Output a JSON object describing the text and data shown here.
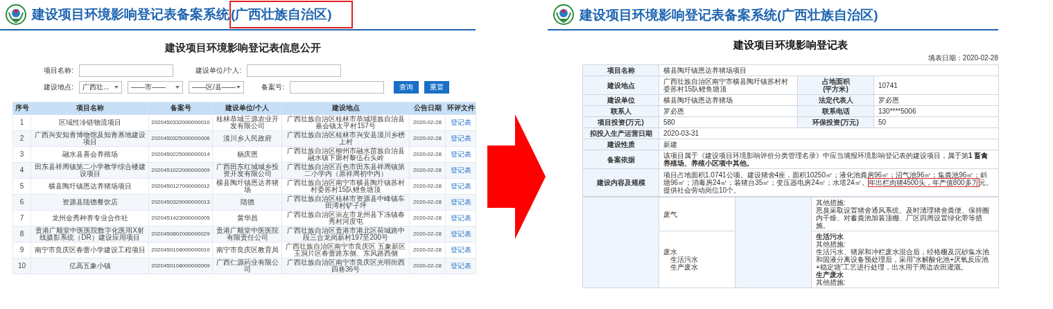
{
  "left": {
    "header": [
      {
        "text": "建设项目环境影响登记表备案系统",
        "highlighted": false
      },
      {
        "text": "(广西壮族自治区)",
        "highlighted": true
      }
    ],
    "page_title": "建设项目环境影响登记表信息公开",
    "search": {
      "name_label": "项目名称:",
      "unit_label": "建设单位/个人:",
      "location_label": "建设地点:",
      "selects": [
        "广西壮...",
        "——市——",
        "——区/县——"
      ],
      "record_label": "备案号:",
      "buttons": [
        "查询",
        "重置"
      ]
    },
    "table": {
      "columns": [
        "序号",
        "项目名称",
        "备案号",
        "建设单位/个人",
        "建设地点",
        "公告日期",
        "环评文件"
      ],
      "rows": [
        [
          "1",
          "区域性冷链物流项目",
          "2020450332000000010",
          "桂林恭城三源农业开发有限公司",
          "广西壮族自治区桂林市恭城瑶族自治县嘉会镇太平村157号",
          "2020-02-28",
          "登记表"
        ],
        [
          "2",
          "广西兴安知青博物馆及知青基地建设项目",
          "2020450325000000006",
          "漠川乡人民政府",
          "广西壮族自治区桂林市兴安县漠川乡榜上村",
          "2020-02-28",
          "登记表"
        ],
        [
          "3",
          "融水县喜会养殖场",
          "2020450225000000014",
          "杨庆恩",
          "广西壮族自治区柳州市融水苗族自治县融水镇下廓村黎伍石头岭",
          "2020-02-28",
          "登记表"
        ],
        [
          "4",
          "田东县祥周镇第二小学教学综合楼建设项目",
          "2020451022000000009",
          "广西田东红城城乡投资开发有限公司",
          "广西壮族自治区百色市田东县祥周镇第二小学内（原祥周初中内）",
          "2020-02-28",
          "登记表"
        ],
        [
          "5",
          "横县陶圩镇恩达养猪场项目",
          "2020450127000000012",
          "横县陶圩镇恩达养猪场",
          "广西壮族自治区南宁市横县陶圩镇苏村村委苏村15队鲤鱼塘顶",
          "2020-02-28",
          "登记表"
        ],
        [
          "6",
          "资源县陆德餐饮店",
          "2020450329000000013",
          "陆德",
          "广西壮族自治区桂林市资源县中峰镇车田湾村铲子坪",
          "2020-02-28",
          "登记表"
        ],
        [
          "7",
          "龙州金秀种养专业合作社",
          "2020451423000000005",
          "黄华昌",
          "广西壮族自治区崇左市龙州县下冻镇春秀村河度屯",
          "2020-02-28",
          "登记表"
        ],
        [
          "8",
          "贵港广顺堂中医医院数字化医用X射线摄影系统（DR）建设应用项目",
          "2020450802000000029",
          "贵港广顺堂中医医院有限责任公司",
          "广西壮族自治区贵港市港北区荷城路中段三合龙岗新村197至200号",
          "2020-02-28",
          "登记表"
        ],
        [
          "9",
          "南宁市良庆区春蕾小学建设工程项目",
          "2020450108000000010",
          "南宁市良庆区教育局",
          "广西壮族自治区南宁市良庆区 五象新区玉洞片区春蕾路东侧、东风路西侧",
          "2020-02-28",
          "登记表"
        ],
        [
          "10",
          "亿高五象小镇",
          "2020450108000000009",
          "广西仁源药业有限公司",
          "广西壮族自治区南宁市良庆区光明街西四巷36号",
          "2020-02-28",
          "登记表"
        ]
      ]
    }
  },
  "right": {
    "header": [
      {
        "text": "建设项目环境影响登记表备案系统(广西壮族自治区)",
        "highlighted": false
      }
    ],
    "form_title": "建设项目环境影响登记表",
    "fill_date": "填表日期：2020-02-28",
    "rows": [
      {
        "kind": "single",
        "label": "项目名称",
        "value": "横县陶圩镇恩达养猪场项目"
      },
      {
        "kind": "pair",
        "label": "建设地点",
        "value": "广西壮族自治区南宁市横县陶圩镇苏村村委苏村15队鲤鱼塘顶",
        "label2": "占地面积\n(平方米)",
        "value2": "10741"
      },
      {
        "kind": "pair",
        "label": "建设单位",
        "value": "横县陶圩镇恩达养猪场",
        "label2": "法定代表人",
        "value2": "罗必恩"
      },
      {
        "kind": "pair",
        "label": "联系人",
        "value": "罗必恩",
        "label2": "联系电话",
        "value2": "130****5006"
      },
      {
        "kind": "pair",
        "label": "项目投资(万元)",
        "value": "580",
        "label2": "环保投资(万元)",
        "value2": "50"
      },
      {
        "kind": "single",
        "label": "拟投入生产运营日期",
        "value": "2020-03-31"
      },
      {
        "kind": "single",
        "label": "建设性质",
        "value": "新建"
      },
      {
        "kind": "single",
        "label": "备案依据",
        "value": "该项目属于《建设项目环境影响评价分类管理名录》中应当填报环境影响登记表的建设项目，属于第**1 畜禽养殖场、养殖小区项中其他。**"
      },
      {
        "kind": "parts",
        "label": "建设内容及规模",
        "parts": [
          {
            "text": "项目占地面积1.0741公顷。建设猪舍4座，面积10250㎡；液化池粪房96㎡；沼气池96㎡；集粪池96㎡；斜塘96㎡；消毒房24㎡；装猪台35㎡；变压器电房24㎡；水塔24㎡。",
            "highlighted": false
          },
          {
            "text": "年出栏肉猪4500头，年产值800多万",
            "highlighted": true
          },
          {
            "text": "元。提供社会劳动岗位10个。",
            "highlighted": false
          }
        ]
      }
    ],
    "pollution": [
      {
        "type": {
          "label": "废气"
        },
        "measures": [
          {
            "text": "其他措施:",
            "bold": false
          },
          {
            "text": "恶臭采取设置猪舍通风系统、及时清理猪舍粪便、保持圈内干燥、对蓄粪池加装顶棚、厂区四周设置绿化带等措施。",
            "bold": false
          }
        ]
      },
      {
        "type": {
          "label": "废水",
          "children": [
            "生活污水",
            "生产废水"
          ]
        },
        "measures": [
          {
            "text": "生活污水",
            "bold": true
          },
          {
            "text": "其他措施:",
            "bold": false
          },
          {
            "text": "生活污水、猪尿和冲栏废水混合后，经格栅及沉砂集水池和固液分离设备预处理后，采用“水解酸化池+厌氧反应池+稳定塘”工艺进行处理，出水用于周边农田灌溉。",
            "bold": false
          },
          {
            "text": "生产废水",
            "bold": true
          },
          {
            "text": "其他措施:",
            "bold": false
          }
        ]
      }
    ]
  }
}
